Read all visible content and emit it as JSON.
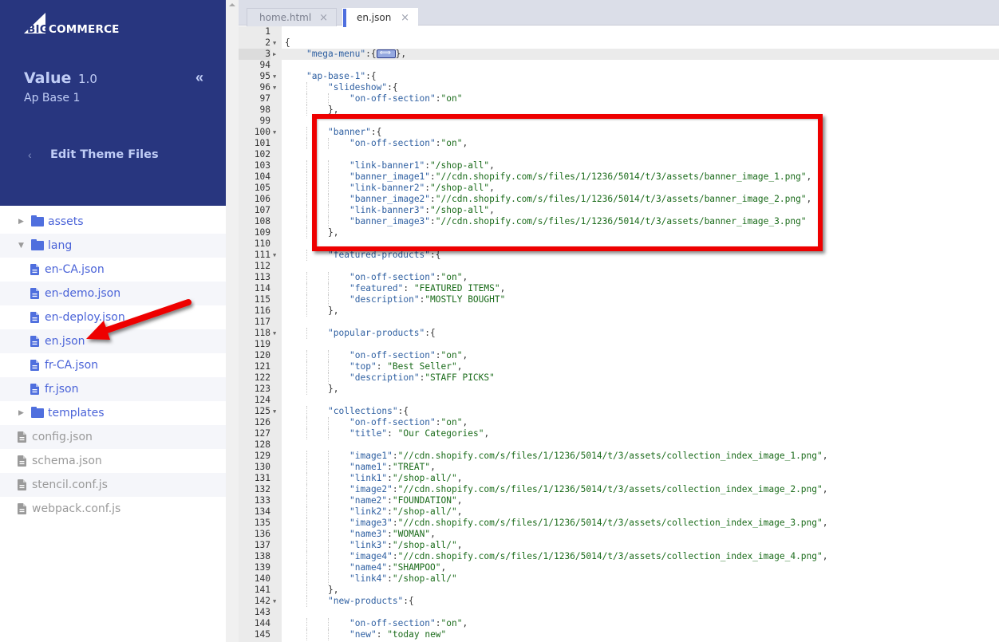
{
  "brand": {
    "logo_prefix": "BIG",
    "logo_suffix": "COMMERCE"
  },
  "sidebar": {
    "theme_name": "Value",
    "theme_version": "1.0",
    "theme_variant": "Ap Base 1",
    "collapse_icon": "double-chevron-left",
    "collapse_glyph": "«",
    "back_glyph": "‹",
    "section_title": "Edit Theme Files",
    "tree": [
      {
        "type": "folder",
        "label": "assets",
        "expanded": false
      },
      {
        "type": "folder",
        "label": "lang",
        "expanded": true
      },
      {
        "type": "lang-file",
        "label": "en-CA.json"
      },
      {
        "type": "lang-file",
        "label": "en-demo.json"
      },
      {
        "type": "lang-file",
        "label": "en-deploy.json"
      },
      {
        "type": "lang-file",
        "label": "en.json",
        "selected": true
      },
      {
        "type": "lang-file",
        "label": "fr-CA.json"
      },
      {
        "type": "lang-file",
        "label": "fr.json"
      },
      {
        "type": "folder",
        "label": "templates",
        "expanded": false
      },
      {
        "type": "root-file",
        "label": "config.json"
      },
      {
        "type": "root-file",
        "label": "schema.json"
      },
      {
        "type": "root-file",
        "label": "stencil.conf.js"
      },
      {
        "type": "root-file",
        "label": "webpack.conf.js"
      }
    ]
  },
  "editor": {
    "tabs": [
      {
        "label": "home.html",
        "close": "×",
        "active": false
      },
      {
        "label": "en.json",
        "close": "×",
        "active": true
      }
    ],
    "active_line": 3,
    "lines": [
      {
        "n": "1",
        "fold": "",
        "indent": 0,
        "text": ""
      },
      {
        "n": "2",
        "fold": "down",
        "indent": 0,
        "text": "{"
      },
      {
        "n": "3",
        "fold": "right",
        "indent": 1,
        "text": "\"mega-menu\":{",
        "folded": true,
        "after": "},"
      },
      {
        "n": "94",
        "fold": "",
        "indent": 0,
        "text": ""
      },
      {
        "n": "95",
        "fold": "down",
        "indent": 1,
        "text": "\"ap-base-1\":{"
      },
      {
        "n": "96",
        "fold": "down",
        "indent": 2,
        "text": "\"slideshow\":{"
      },
      {
        "n": "97",
        "fold": "",
        "indent": 3,
        "text": "\"on-off-section\":\"on\""
      },
      {
        "n": "98",
        "fold": "",
        "indent": 2,
        "text": "},"
      },
      {
        "n": "99",
        "fold": "",
        "indent": 0,
        "text": ""
      },
      {
        "n": "100",
        "fold": "down",
        "indent": 2,
        "text": "\"banner\":{"
      },
      {
        "n": "101",
        "fold": "",
        "indent": 3,
        "text": "\"on-off-section\":\"on\","
      },
      {
        "n": "102",
        "fold": "",
        "indent": 0,
        "text": ""
      },
      {
        "n": "103",
        "fold": "",
        "indent": 3,
        "text": "\"link-banner1\":\"/shop-all\","
      },
      {
        "n": "104",
        "fold": "",
        "indent": 3,
        "text": "\"banner_image1\":\"//cdn.shopify.com/s/files/1/1236/5014/t/3/assets/banner_image_1.png\","
      },
      {
        "n": "105",
        "fold": "",
        "indent": 3,
        "text": "\"link-banner2\":\"/shop-all\","
      },
      {
        "n": "106",
        "fold": "",
        "indent": 3,
        "text": "\"banner_image2\":\"//cdn.shopify.com/s/files/1/1236/5014/t/3/assets/banner_image_2.png\","
      },
      {
        "n": "107",
        "fold": "",
        "indent": 3,
        "text": "\"link-banner3\":\"/shop-all\","
      },
      {
        "n": "108",
        "fold": "",
        "indent": 3,
        "text": "\"banner_image3\":\"//cdn.shopify.com/s/files/1/1236/5014/t/3/assets/banner_image_3.png\""
      },
      {
        "n": "109",
        "fold": "",
        "indent": 2,
        "text": "},"
      },
      {
        "n": "110",
        "fold": "",
        "indent": 0,
        "text": ""
      },
      {
        "n": "111",
        "fold": "down",
        "indent": 2,
        "text": "\"featured-products\":{"
      },
      {
        "n": "112",
        "fold": "",
        "indent": 0,
        "text": ""
      },
      {
        "n": "113",
        "fold": "",
        "indent": 3,
        "text": "\"on-off-section\":\"on\","
      },
      {
        "n": "114",
        "fold": "",
        "indent": 3,
        "text": "\"featured\": \"FEATURED ITEMS\","
      },
      {
        "n": "115",
        "fold": "",
        "indent": 3,
        "text": "\"description\":\"MOSTLY BOUGHT\""
      },
      {
        "n": "116",
        "fold": "",
        "indent": 2,
        "text": "},"
      },
      {
        "n": "117",
        "fold": "",
        "indent": 0,
        "text": ""
      },
      {
        "n": "118",
        "fold": "down",
        "indent": 2,
        "text": "\"popular-products\":{"
      },
      {
        "n": "119",
        "fold": "",
        "indent": 0,
        "text": ""
      },
      {
        "n": "120",
        "fold": "",
        "indent": 3,
        "text": "\"on-off-section\":\"on\","
      },
      {
        "n": "121",
        "fold": "",
        "indent": 3,
        "text": "\"top\": \"Best Seller\","
      },
      {
        "n": "122",
        "fold": "",
        "indent": 3,
        "text": "\"description\":\"STAFF PICKS\""
      },
      {
        "n": "123",
        "fold": "",
        "indent": 2,
        "text": "},"
      },
      {
        "n": "124",
        "fold": "",
        "indent": 0,
        "text": ""
      },
      {
        "n": "125",
        "fold": "down",
        "indent": 2,
        "text": "\"collections\":{"
      },
      {
        "n": "126",
        "fold": "",
        "indent": 3,
        "text": "\"on-off-section\":\"on\","
      },
      {
        "n": "127",
        "fold": "",
        "indent": 3,
        "text": "\"title\": \"Our Categories\","
      },
      {
        "n": "128",
        "fold": "",
        "indent": 0,
        "text": ""
      },
      {
        "n": "129",
        "fold": "",
        "indent": 3,
        "text": "\"image1\":\"//cdn.shopify.com/s/files/1/1236/5014/t/3/assets/collection_index_image_1.png\","
      },
      {
        "n": "130",
        "fold": "",
        "indent": 3,
        "text": "\"name1\":\"TREAT\","
      },
      {
        "n": "131",
        "fold": "",
        "indent": 3,
        "text": "\"link1\":\"/shop-all/\","
      },
      {
        "n": "132",
        "fold": "",
        "indent": 3,
        "text": "\"image2\":\"//cdn.shopify.com/s/files/1/1236/5014/t/3/assets/collection_index_image_2.png\","
      },
      {
        "n": "133",
        "fold": "",
        "indent": 3,
        "text": "\"name2\":\"FOUNDATION\","
      },
      {
        "n": "134",
        "fold": "",
        "indent": 3,
        "text": "\"link2\":\"/shop-all/\","
      },
      {
        "n": "135",
        "fold": "",
        "indent": 3,
        "text": "\"image3\":\"//cdn.shopify.com/s/files/1/1236/5014/t/3/assets/collection_index_image_3.png\","
      },
      {
        "n": "136",
        "fold": "",
        "indent": 3,
        "text": "\"name3\":\"WOMAN\","
      },
      {
        "n": "137",
        "fold": "",
        "indent": 3,
        "text": "\"link3\":\"/shop-all/\","
      },
      {
        "n": "138",
        "fold": "",
        "indent": 3,
        "text": "\"image4\":\"//cdn.shopify.com/s/files/1/1236/5014/t/3/assets/collection_index_image_4.png\","
      },
      {
        "n": "139",
        "fold": "",
        "indent": 3,
        "text": "\"name4\":\"SHAMPOO\","
      },
      {
        "n": "140",
        "fold": "",
        "indent": 3,
        "text": "\"link4\":\"/shop-all/\""
      },
      {
        "n": "141",
        "fold": "",
        "indent": 2,
        "text": "},"
      },
      {
        "n": "142",
        "fold": "down",
        "indent": 2,
        "text": "\"new-products\":{"
      },
      {
        "n": "143",
        "fold": "",
        "indent": 0,
        "text": ""
      },
      {
        "n": "144",
        "fold": "",
        "indent": 3,
        "text": "\"on-off-section\":\"on\","
      },
      {
        "n": "145",
        "fold": "",
        "indent": 3,
        "text": "\"new\": \"today new\""
      }
    ]
  },
  "annotations": {
    "highlight_color": "#e00000",
    "highlight_target": "banner block (lines 100-109)",
    "arrow_target": "en.json"
  },
  "colors": {
    "sidebar_bg": "#28367f",
    "sidebar_text": "#c0cdf6",
    "link_blue": "#4a63d8",
    "folder_blue": "#4f6fde",
    "muted_gray": "#9a9a9a",
    "tabbar_bg": "#dbdee8",
    "gutter_bg": "#ebebeb",
    "json_key": "#2e5fa1",
    "json_string": "#1a6b1a"
  }
}
